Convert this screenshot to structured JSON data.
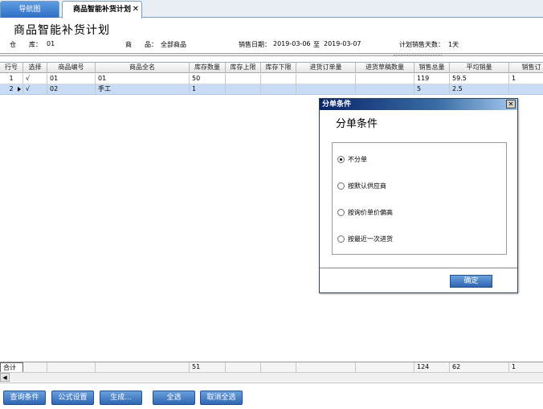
{
  "tabs": [
    {
      "label": "导航图"
    },
    {
      "label": "商品智能补货计划",
      "close": "✕"
    }
  ],
  "page": {
    "title": "商品智能补货计划"
  },
  "filters": {
    "warehouse_label": "仓　　库：",
    "warehouse_value": "01",
    "goods_label": "商　　品：",
    "goods_value": "全部商品",
    "sales_date_label": "销售日期：",
    "sales_date_from": "2019-03-06",
    "date_to": "至",
    "sales_date_to": "2019-03-07",
    "plan_days_label": "计划销售天数：",
    "plan_days_value": "1天"
  },
  "grid": {
    "columns": [
      "行号",
      "选择",
      "商品编号",
      "商品全名",
      "库存数量",
      "库存上限",
      "库存下限",
      "进货订单量",
      "进货草稿数量",
      "销售总量",
      "平均销量",
      "销售订"
    ],
    "rows": [
      {
        "no": "1",
        "check": "√",
        "code": "01",
        "name": "01",
        "stock": "50",
        "upper": "",
        "lower": "",
        "order": "",
        "draft": "",
        "sales_total": "119",
        "avg_sales": "59.5",
        "sales_order": "1"
      },
      {
        "no": "2",
        "check": "√",
        "code": "02",
        "name": "手工",
        "stock": "1",
        "upper": "",
        "lower": "",
        "order": "",
        "draft": "",
        "sales_total": "5",
        "avg_sales": "2.5",
        "sales_order": ""
      }
    ],
    "totals": {
      "label": "合计",
      "stock": "51",
      "sales_total": "124",
      "avg_sales": "62",
      "sales_order": "1"
    }
  },
  "toolbar": {
    "query": "查询条件",
    "formula": "公式设置",
    "generate": "生成...",
    "select_all": "全选",
    "deselect_all": "取消全选"
  },
  "dialog": {
    "title": "分单条件",
    "close": "✕",
    "heading": "分单条件",
    "options": [
      {
        "label": "不分单",
        "selected": true
      },
      {
        "label": "按默认供应商",
        "selected": false
      },
      {
        "label": "按询价单价偏高",
        "selected": false
      },
      {
        "label": "按最近一次进货",
        "selected": false
      }
    ],
    "ok": "确定"
  },
  "colors": {
    "accent": "#2f66b3",
    "selected_row": "#c8ddf5",
    "dialog_title": "#0a246a"
  }
}
